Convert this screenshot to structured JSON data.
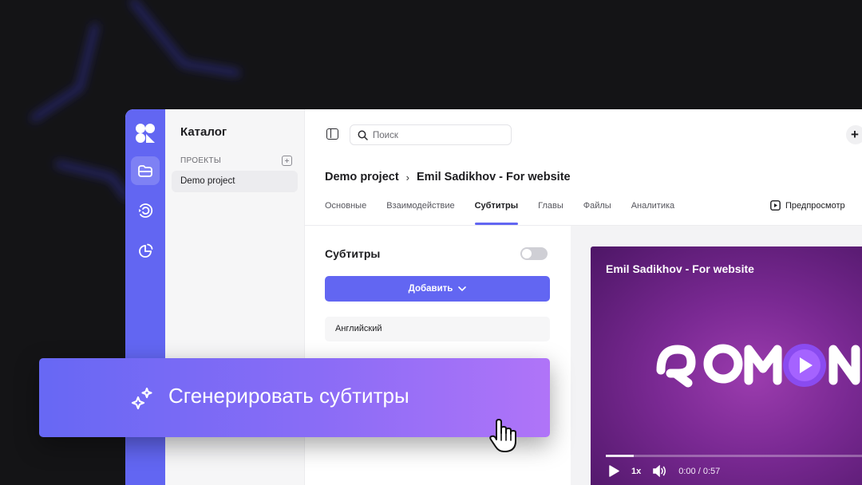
{
  "sidebar": {
    "title": "Каталог",
    "projects_label": "ПРОЕКТЫ",
    "projects": [
      "Demo project"
    ]
  },
  "rail": {
    "items": [
      "logo-icon",
      "folder-icon",
      "broadcast-icon",
      "analytics-icon"
    ]
  },
  "topbar": {
    "search_placeholder": "Поиск",
    "add_label": "+"
  },
  "breadcrumb": {
    "project": "Demo project",
    "separator": "›",
    "video": "Emil Sadikhov - For website"
  },
  "tabs": [
    "Основные",
    "Взаимодействие",
    "Субтитры",
    "Главы",
    "Файлы",
    "Аналитика"
  ],
  "active_tab": "Субтитры",
  "preview_label": "Предпросмотр",
  "subtitles": {
    "title": "Субтитры",
    "enabled": false,
    "add_button": "Добавить",
    "languages": [
      "Английский"
    ]
  },
  "player": {
    "title": "Emil Sadikhov - For website",
    "logo_text": "ROMAN",
    "speed": "1x",
    "time": "0:00 / 0:57",
    "progress_fraction": 0.11
  },
  "banner": {
    "label": "Сгенерировать субтитры"
  },
  "colors": {
    "accent": "#6266f2",
    "banner_start": "#6768f4",
    "banner_end": "#b074f8",
    "player_bg": "#7a2993"
  }
}
